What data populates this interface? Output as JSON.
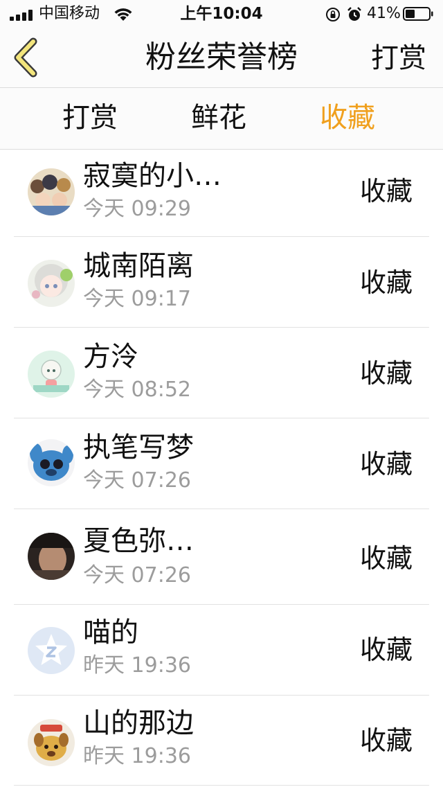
{
  "status_bar": {
    "carrier": "中国移动",
    "time": "上午10:04",
    "battery": "41%"
  },
  "nav": {
    "title": "粉丝荣誉榜",
    "right_button": "打赏",
    "back_icon": "chevron-left-icon",
    "accent_color": "#f0a01e"
  },
  "tabs": [
    {
      "label": "打赏",
      "active": false
    },
    {
      "label": "鲜花",
      "active": false
    },
    {
      "label": "收藏",
      "active": true
    }
  ],
  "fans": [
    {
      "name": "寂寞的小…",
      "time": "今天 09:29",
      "action": "收藏",
      "avatar": "anime-group-avatar"
    },
    {
      "name": "城南陌离",
      "time": "今天 09:17",
      "action": "收藏",
      "avatar": "anime-girl-avatar"
    },
    {
      "name": "方泠",
      "time": "今天 08:52",
      "action": "收藏",
      "avatar": "chibi-avatar"
    },
    {
      "name": "执笔写梦",
      "time": "今天 07:26",
      "action": "收藏",
      "avatar": "stitch-avatar"
    },
    {
      "name": "夏色弥…",
      "time": "今天 07:26",
      "action": "收藏",
      "avatar": "photo-avatar"
    },
    {
      "name": "喵的",
      "time": "昨天 19:36",
      "action": "收藏",
      "avatar": "default-star-avatar"
    },
    {
      "name": "山的那边",
      "time": "昨天 19:36",
      "action": "收藏",
      "avatar": "cartoon-dog-avatar"
    }
  ]
}
